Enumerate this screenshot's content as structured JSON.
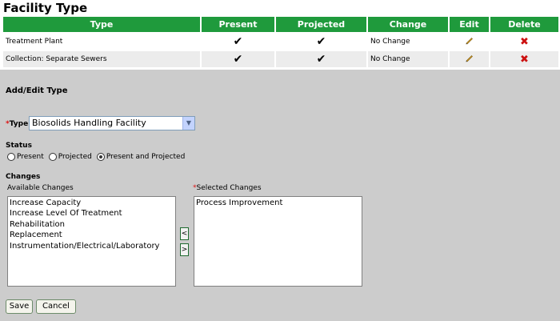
{
  "page": {
    "title": "Facility Type"
  },
  "table": {
    "columns": [
      "Type",
      "Present",
      "Projected",
      "Change",
      "Edit",
      "Delete"
    ],
    "rows": [
      {
        "type": "Treatment Plant",
        "present": "✔",
        "projected": "✔",
        "change": "No Change"
      },
      {
        "type": "Collection: Separate Sewers",
        "present": "✔",
        "projected": "✔",
        "change": "No Change"
      }
    ]
  },
  "form": {
    "title": "Add/Edit Type",
    "required_mark": "*",
    "type_label": "Type",
    "type_value": "Biosolids Handling Facility",
    "status_label": "Status",
    "status_options": [
      "Present",
      "Projected",
      "Present and Projected"
    ],
    "status_selected": "Present and Projected",
    "changes_label": "Changes",
    "available_label": "Available Changes",
    "selected_label": "Selected Changes",
    "available_changes": [
      "Increase Capacity",
      "Increase Level Of Treatment",
      "Rehabilitation",
      "Replacement",
      "Instrumentation/Electrical/Laboratory"
    ],
    "selected_changes": [
      "Process Improvement"
    ],
    "move_left_label": "<",
    "move_right_label": ">",
    "save_label": "Save",
    "cancel_label": "Cancel"
  },
  "colors": {
    "header_green": "#1f9a3c",
    "panel_gray": "#cccccc",
    "required_red": "#dd1111",
    "delete_red": "#cc1111"
  },
  "icons": {
    "edit": "pencil-icon",
    "delete": "delete-x-icon",
    "check": "check-icon"
  }
}
